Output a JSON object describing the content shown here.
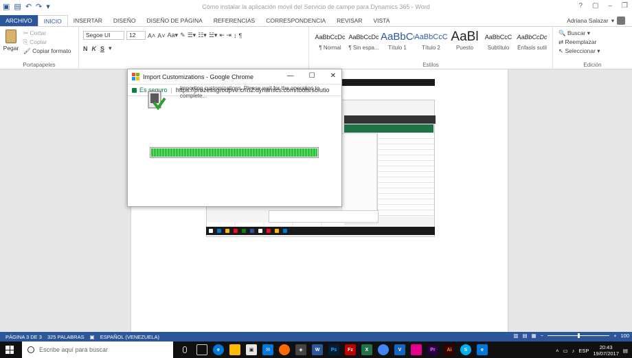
{
  "word": {
    "title": "Cómo instalar la aplicación móvil del Servicio de campo para Dynamics 365 - Word",
    "user": "Adriana Salazar",
    "tabs": [
      "ARCHIVO",
      "INICIO",
      "INSERTAR",
      "DISEÑO",
      "DISEÑO DE PÁGINA",
      "REFERENCIAS",
      "CORRESPONDENCIA",
      "REVISAR",
      "VISTA"
    ],
    "clipboard": {
      "paste": "Pegar",
      "cut": "Cortar",
      "copy": "Copiar",
      "format_painter": "Copiar formato",
      "group": "Portapapeles"
    },
    "font": {
      "name": "Segoe UI",
      "size": "12"
    },
    "styles": {
      "group": "Estilos",
      "items": [
        {
          "sample": "AaBbCcDc",
          "name": "¶ Normal"
        },
        {
          "sample": "AaBbCcDc",
          "name": "¶ Sin espa..."
        },
        {
          "sample": "AaBbCc",
          "name": "Título 1"
        },
        {
          "sample": "AaBbCcC",
          "name": "Título 2"
        },
        {
          "sample": "AaBl",
          "name": "Puesto"
        },
        {
          "sample": "AaBbCcC",
          "name": "Subtítulo"
        },
        {
          "sample": "AaBbCcDc",
          "name": "Énfasis sutil"
        }
      ]
    },
    "editing": {
      "find": "Buscar",
      "replace": "Reemplazar",
      "select": "Seleccionar",
      "group": "Edición"
    },
    "status": {
      "page": "PÁGINA 3 DE 3",
      "words": "325 PALABRAS",
      "lang": "ESPAÑOL (VENEZUELA)",
      "zoom": "100"
    }
  },
  "popup": {
    "title": "Import Customizations - Google Chrome",
    "secure": "Es seguro",
    "url": "https://prozessgroupve.crm2.dynamics.com/tools/solutio",
    "message": "Importing customizations. Please wait for the operation to complete...",
    "progress": 1.0
  },
  "taskbar": {
    "search_placeholder": "Escribe aquí para buscar",
    "lang": "ESP",
    "time": "20:43",
    "date": "19/07/2017"
  },
  "colors": {
    "word_blue": "#2b579a",
    "progress_green": "#2ec23f",
    "secure_green": "#0b8043"
  }
}
